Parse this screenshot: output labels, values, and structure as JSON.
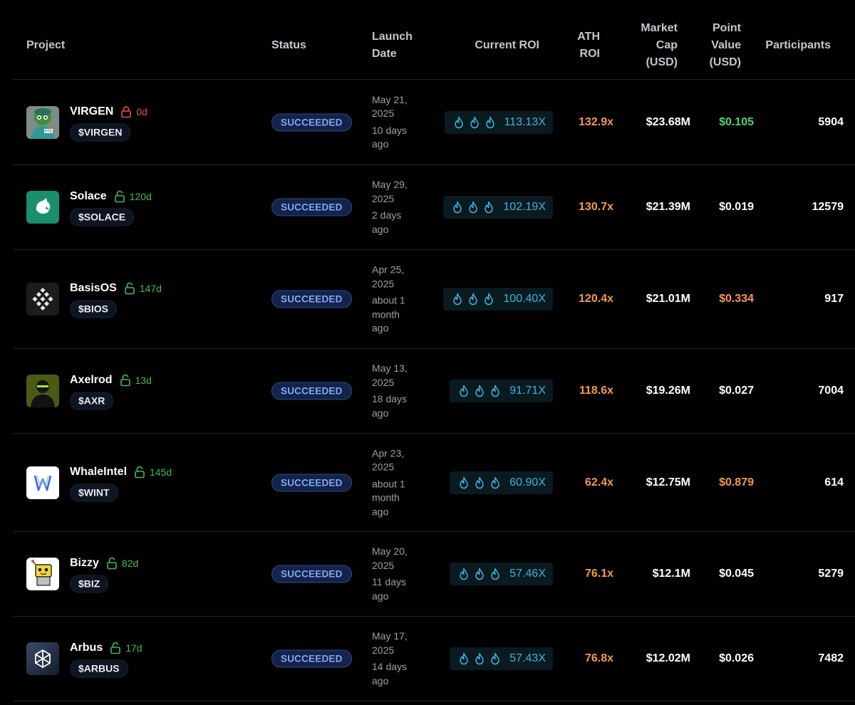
{
  "headers": {
    "project": "Project",
    "status": "Status",
    "launch": [
      "Launch",
      "Date"
    ],
    "current_roi": "Current ROI",
    "ath_roi": [
      "ATH",
      "ROI"
    ],
    "market_cap": [
      "Market",
      "Cap",
      "(USD)"
    ],
    "point_value": [
      "Point",
      "Value",
      "(USD)"
    ],
    "participants": "Participants"
  },
  "colors": {
    "background": "#010101",
    "status_text": "#7fa8f5",
    "roi_text": "#3ab5d9",
    "ath_text": "#f59a4a",
    "lock_red": "#e5534b",
    "lock_green": "#3fbb5a",
    "point_green": "#4fd27a",
    "point_orange": "#f59a4a"
  },
  "rows": [
    {
      "name": "VIRGEN",
      "ticker": "$VIRGEN",
      "logo": "frog-pts-logo",
      "lock": "0d",
      "lock_color": "red",
      "status": "SUCCEEDED",
      "launch_date": [
        "May 21,",
        "2025"
      ],
      "launch_ago": [
        "10 days",
        "ago"
      ],
      "current_roi": "113.13X",
      "ath_roi": "132.9x",
      "market_cap": "$23.68M",
      "point_value": "$0.105",
      "point_color": "green",
      "participants": "5904"
    },
    {
      "name": "Solace",
      "ticker": "$SOLACE",
      "logo": "solace-logo",
      "lock": "120d",
      "lock_color": "green",
      "status": "SUCCEEDED",
      "launch_date": [
        "May 29,",
        "2025"
      ],
      "launch_ago": [
        "2 days",
        "ago"
      ],
      "current_roi": "102.19X",
      "ath_roi": "130.7x",
      "market_cap": "$21.39M",
      "point_value": "$0.019",
      "point_color": "white",
      "participants": "12579"
    },
    {
      "name": "BasisOS",
      "ticker": "$BIOS",
      "logo": "basisos-logo",
      "lock": "147d",
      "lock_color": "green",
      "status": "SUCCEEDED",
      "launch_date": [
        "Apr 25,",
        "2025"
      ],
      "launch_ago": [
        "about 1",
        "month",
        "ago"
      ],
      "current_roi": "100.40X",
      "ath_roi": "120.4x",
      "market_cap": "$21.01M",
      "point_value": "$0.334",
      "point_color": "orange",
      "participants": "917"
    },
    {
      "name": "Axelrod",
      "ticker": "$AXR",
      "logo": "axelrod-logo",
      "lock": "13d",
      "lock_color": "green",
      "status": "SUCCEEDED",
      "launch_date": [
        "May 13,",
        "2025"
      ],
      "launch_ago": [
        "18 days",
        "ago"
      ],
      "current_roi": "91.71X",
      "ath_roi": "118.6x",
      "market_cap": "$19.26M",
      "point_value": "$0.027",
      "point_color": "white",
      "participants": "7004"
    },
    {
      "name": "WhaleIntel",
      "ticker": "$WINT",
      "logo": "whaleintel-logo",
      "lock": "145d",
      "lock_color": "green",
      "status": "SUCCEEDED",
      "launch_date": [
        "Apr 23,",
        "2025"
      ],
      "launch_ago": [
        "about 1",
        "month",
        "ago"
      ],
      "current_roi": "60.90X",
      "ath_roi": "62.4x",
      "market_cap": "$12.75M",
      "point_value": "$0.879",
      "point_color": "orange",
      "participants": "614"
    },
    {
      "name": "Bizzy",
      "ticker": "$BIZ",
      "logo": "bizzy-logo",
      "lock": "82d",
      "lock_color": "green",
      "status": "SUCCEEDED",
      "launch_date": [
        "May 20,",
        "2025"
      ],
      "launch_ago": [
        "11 days",
        "ago"
      ],
      "current_roi": "57.46X",
      "ath_roi": "76.1x",
      "market_cap": "$12.1M",
      "point_value": "$0.045",
      "point_color": "white",
      "participants": "5279"
    },
    {
      "name": "Arbus",
      "ticker": "$ARBUS",
      "logo": "arbus-logo",
      "lock": "17d",
      "lock_color": "green",
      "status": "SUCCEEDED",
      "launch_date": [
        "May 17,",
        "2025"
      ],
      "launch_ago": [
        "14 days",
        "ago"
      ],
      "current_roi": "57.43X",
      "ath_roi": "76.8x",
      "market_cap": "$12.02M",
      "point_value": "$0.026",
      "point_color": "white",
      "participants": "7482"
    }
  ]
}
